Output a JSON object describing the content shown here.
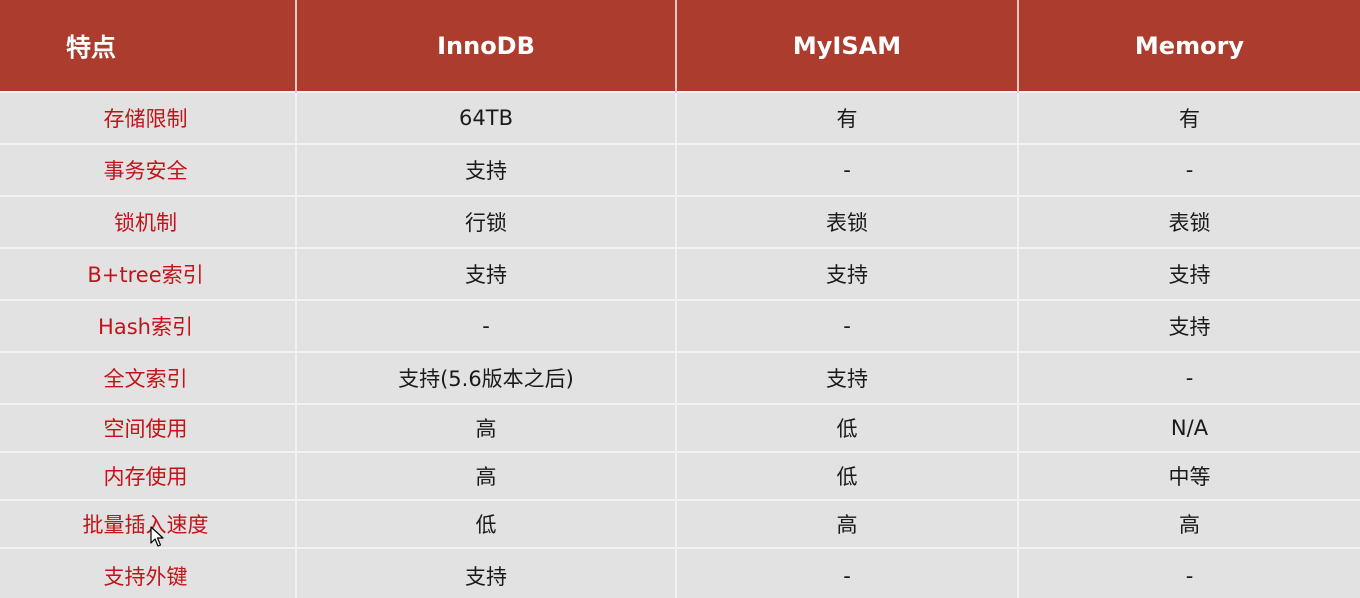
{
  "table": {
    "headers": [
      "特点",
      "InnoDB",
      "MyISAM",
      "Memory"
    ],
    "rows": [
      {
        "feature": "存储限制",
        "innodb": "64TB",
        "myisam": "有",
        "memory": "有"
      },
      {
        "feature": "事务安全",
        "innodb": "支持",
        "myisam": "-",
        "memory": "-"
      },
      {
        "feature": "锁机制",
        "innodb": "行锁",
        "myisam": "表锁",
        "memory": "表锁"
      },
      {
        "feature": "B+tree索引",
        "innodb": "支持",
        "myisam": "支持",
        "memory": "支持"
      },
      {
        "feature": "Hash索引",
        "innodb": "-",
        "myisam": "-",
        "memory": "支持"
      },
      {
        "feature": "全文索引",
        "innodb": "支持(5.6版本之后)",
        "myisam": "支持",
        "memory": "-"
      },
      {
        "feature": "空间使用",
        "innodb": "高",
        "myisam": "低",
        "memory": "N/A"
      },
      {
        "feature": "内存使用",
        "innodb": "高",
        "myisam": "低",
        "memory": "中等"
      },
      {
        "feature": "批量插入速度",
        "innodb": "低",
        "myisam": "高",
        "memory": "高"
      },
      {
        "feature": "支持外键",
        "innodb": "支持",
        "myisam": "-",
        "memory": "-"
      }
    ]
  },
  "colors": {
    "header_bg": "#ab3c2e",
    "header_text": "#ffffff",
    "body_bg": "#e2e2e2",
    "feature_text": "#c0141a",
    "cell_text": "#1a1a1a"
  },
  "cursor_icon": "mouse-pointer-icon"
}
